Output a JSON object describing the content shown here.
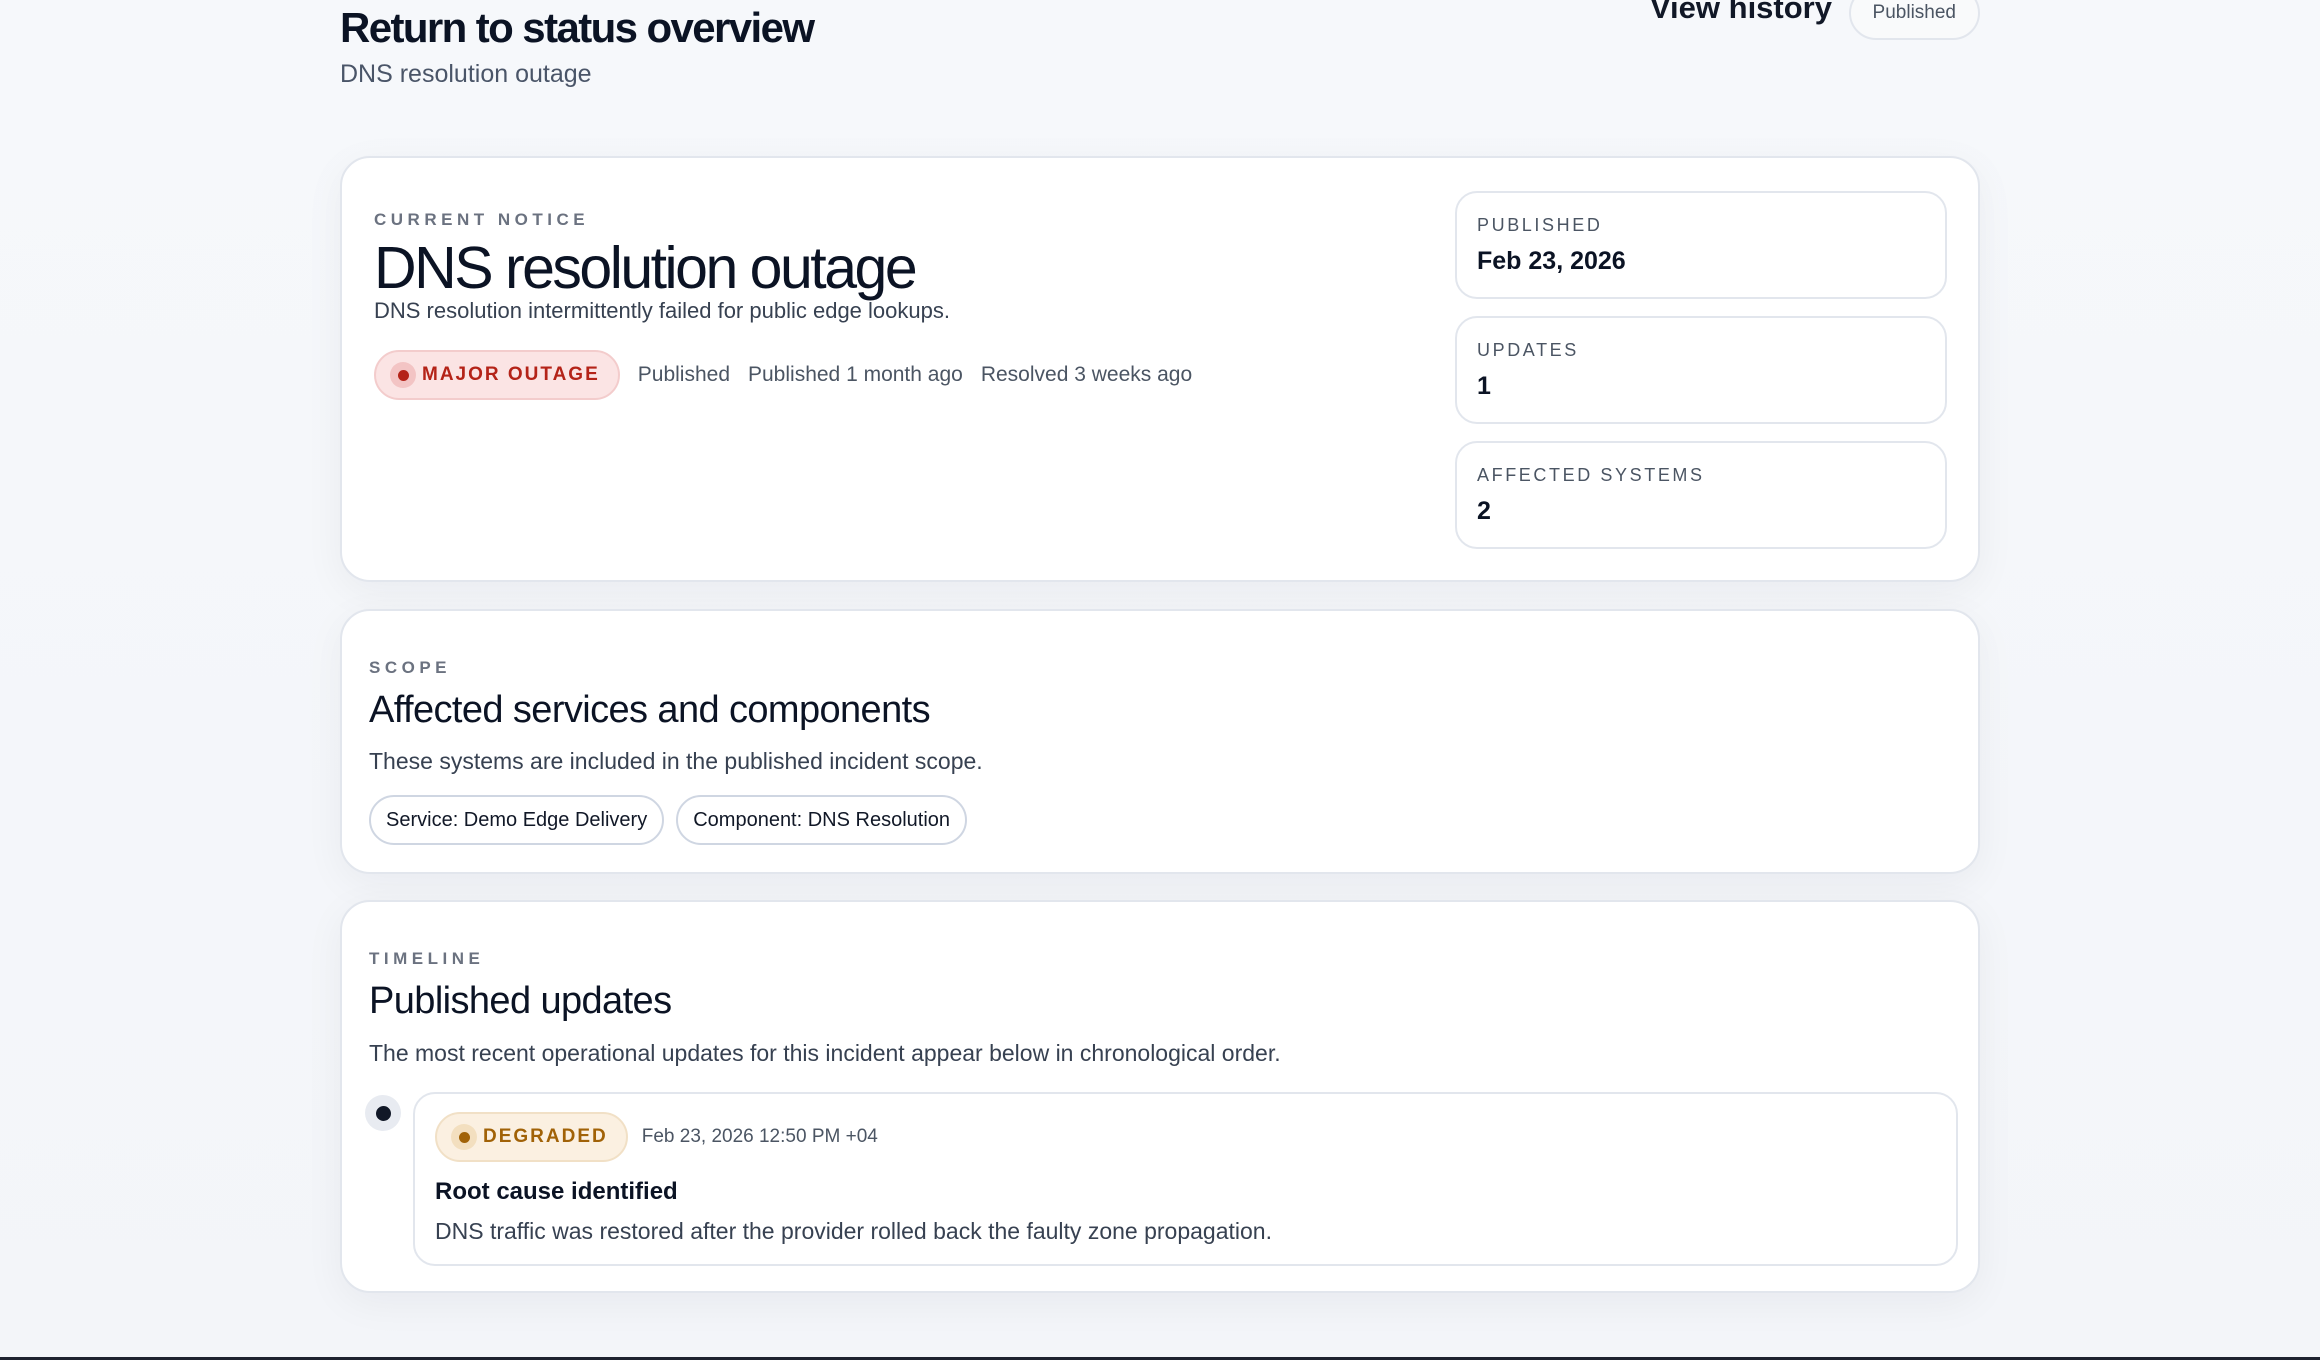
{
  "header": {
    "back_label": "Return to status overview",
    "subtitle": "DNS resolution outage",
    "history_label": "View history",
    "status_chip": "Published"
  },
  "notice": {
    "eyebrow": "CURRENT NOTICE",
    "title": "DNS resolution outage",
    "description": "DNS resolution intermittently failed for public edge lookups.",
    "severity": "MAJOR OUTAGE",
    "state": "Published",
    "published_ago": "Published 1 month ago",
    "resolved_ago": "Resolved 3 weeks ago",
    "stats": [
      {
        "label": "PUBLISHED",
        "value": "Feb 23, 2026"
      },
      {
        "label": "UPDATES",
        "value": "1"
      },
      {
        "label": "AFFECTED SYSTEMS",
        "value": "2"
      }
    ]
  },
  "scope": {
    "eyebrow": "SCOPE",
    "title": "Affected services and components",
    "description": "These systems are included in the published incident scope.",
    "tags": [
      "Service: Demo Edge Delivery",
      "Component: DNS Resolution"
    ]
  },
  "timeline": {
    "eyebrow": "TIMELINE",
    "title": "Published updates",
    "description": "The most recent operational updates for this incident appear below in chronological order.",
    "updates": [
      {
        "status": "DEGRADED",
        "time": "Feb 23, 2026 12:50 PM +04",
        "title": "Root cause identified",
        "body": "DNS traffic was restored after the provider rolled back the faulty zone propagation."
      }
    ]
  },
  "colors": {
    "major_outage": "#b42318",
    "degraded": "#a16207",
    "text_primary": "#0b1324"
  }
}
